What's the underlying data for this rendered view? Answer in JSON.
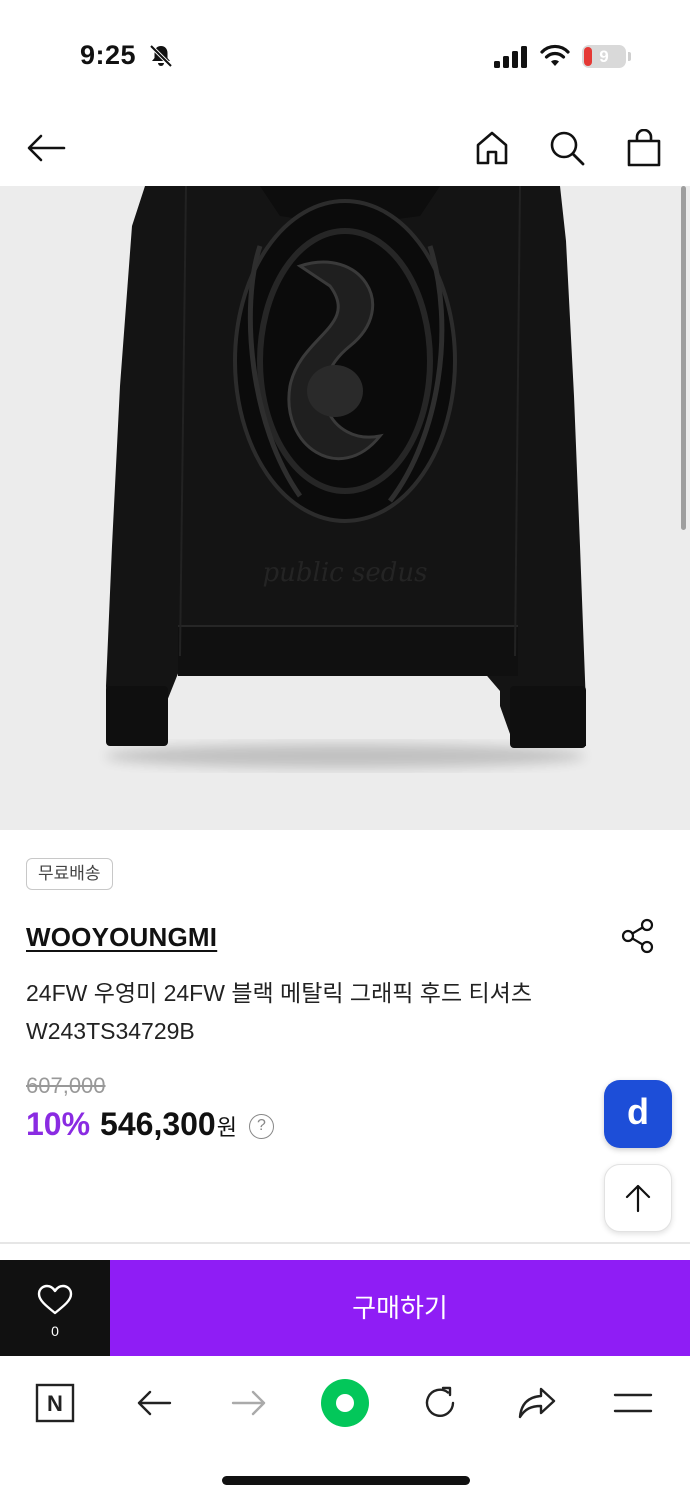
{
  "status_bar": {
    "time": "9:25",
    "battery_level": "9",
    "icons": [
      "bell-off-icon",
      "signal-icon",
      "wifi-icon",
      "battery-icon"
    ],
    "battery_color": "#e53935"
  },
  "nav": {
    "icons": [
      "back-arrow-icon",
      "home-icon",
      "search-icon",
      "shopping-bag-icon"
    ]
  },
  "product": {
    "image_description_icon": "hoodie-image",
    "badge": "무료배송",
    "brand": "WOOYOUNGMI",
    "title": "24FW 우영미 24FW 블랙 메탈릭 그래픽 후드 티셔츠 W243TS34729B",
    "original_price": "607,000",
    "discount": "10%",
    "sale_price": "546,300",
    "currency": "원",
    "help_symbol": "?",
    "discount_color": "#8a2be2"
  },
  "floating": {
    "d_label": "d",
    "d_color": "#1d4ed8"
  },
  "purchase_bar": {
    "wish_count": "0",
    "buy_label": "구매하기",
    "buy_color": "#8f1df5"
  },
  "browser_toolbar": {
    "n_label": "N",
    "icons": [
      "naver-n-icon",
      "back-icon",
      "forward-icon",
      "green-dot-icon",
      "reload-icon",
      "share-icon",
      "menu-icon"
    ]
  }
}
